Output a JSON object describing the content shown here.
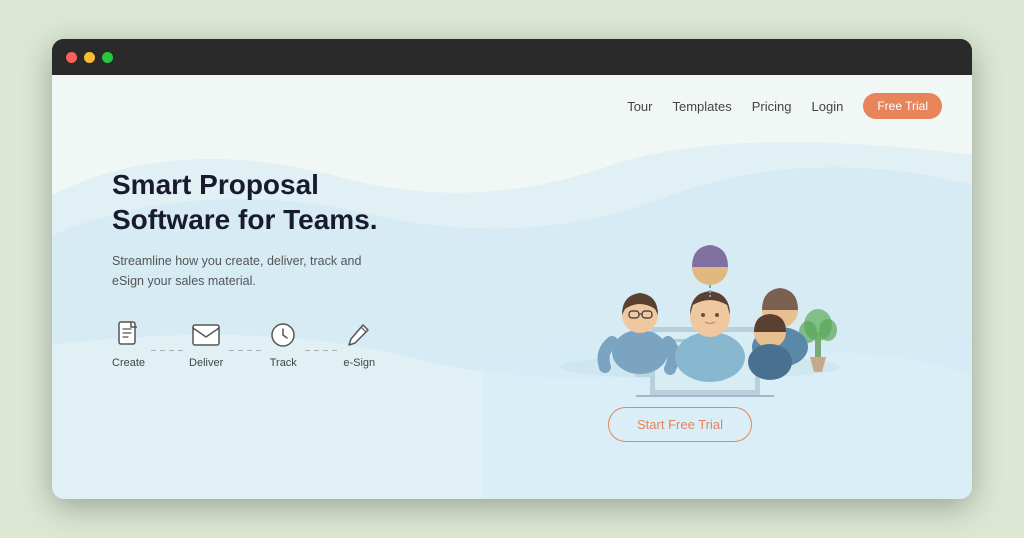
{
  "browser": {
    "dots": [
      "red",
      "yellow",
      "green"
    ]
  },
  "navbar": {
    "links": [
      "Tour",
      "Templates",
      "Pricing",
      "Login"
    ],
    "cta_label": "Free Trial"
  },
  "hero": {
    "title_line1": "Smart Proposal",
    "title_line2": "Software for Teams.",
    "subtitle": "Streamline how you create, deliver, track and eSign your sales material.",
    "steps": [
      {
        "icon": "document",
        "label": "Create"
      },
      {
        "icon": "email",
        "label": "Deliver"
      },
      {
        "icon": "clock",
        "label": "Track"
      },
      {
        "icon": "pen",
        "label": "e-Sign"
      }
    ]
  },
  "cta": {
    "label": "Start Free Trial"
  },
  "colors": {
    "accent": "#e8845a",
    "title": "#1a1a2e",
    "text": "#555555",
    "illustration_light": "#c8dfe8",
    "illustration_mid": "#a0c4d4",
    "illustration_dark": "#4a7a94"
  }
}
